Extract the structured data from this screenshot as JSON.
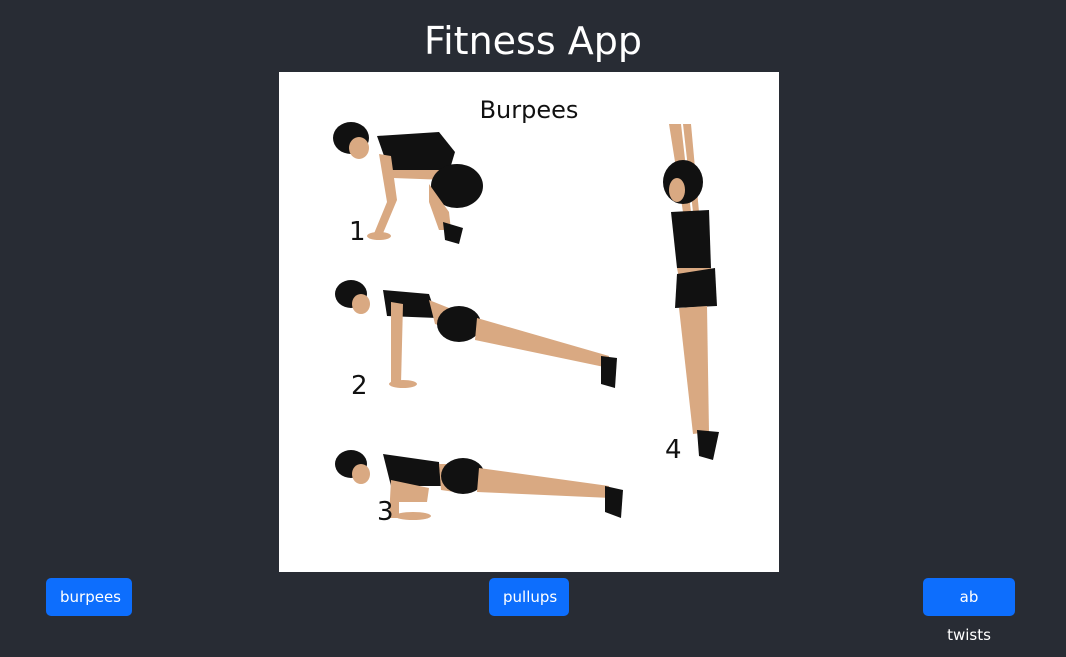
{
  "app": {
    "title": "Fitness App"
  },
  "exercise": {
    "title": "Burpees",
    "steps": [
      "1",
      "2",
      "3",
      "4"
    ],
    "image_description_icon": "burpees-illustration"
  },
  "buttons": {
    "burpees": "burpees",
    "pullups": "pullups",
    "ab_twists": "ab twists"
  },
  "colors": {
    "background": "#282c34",
    "button": "#0d6efd",
    "skin": "#d9a982",
    "clothing": "#111111"
  }
}
